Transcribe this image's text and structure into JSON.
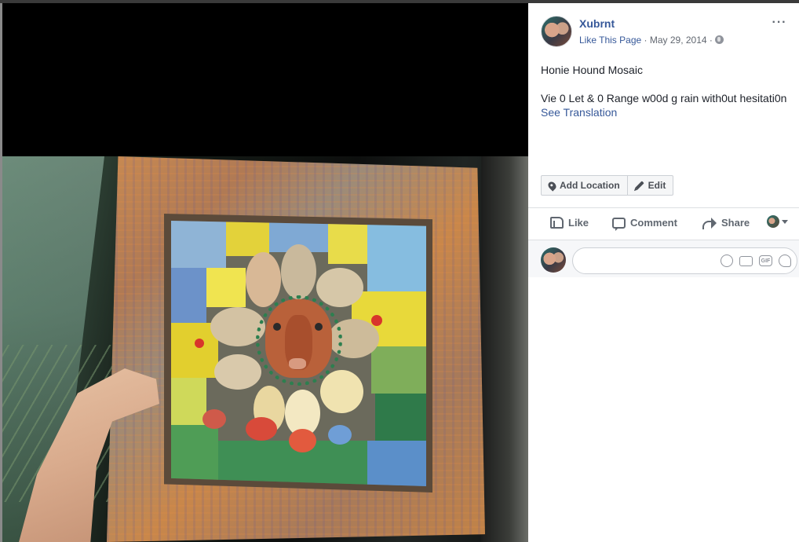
{
  "post": {
    "page_name": "Xubrnt",
    "like_page_label": "Like This Page",
    "separator": "·",
    "date": "May 29, 2014",
    "more_label": "···",
    "title": "Honie Hound Mosaic",
    "body": "Vie 0 Let & 0 Range w00d g rain with0ut hesitati0n",
    "see_translation_label": "See Translation"
  },
  "tag_buttons": {
    "add_location_label": "Add Location",
    "edit_label": "Edit"
  },
  "actions": {
    "like_label": "Like",
    "comment_label": "Comment",
    "share_label": "Share"
  },
  "comment_box": {
    "placeholder": "",
    "icons": [
      "emoji-icon",
      "camera-icon",
      "gif-icon",
      "sticker-icon"
    ],
    "gif_glyph": "GIF"
  },
  "colors": {
    "link_blue": "#365899",
    "text_dark": "#1d2129",
    "text_gray": "#616770",
    "photo_background": "#000000"
  }
}
